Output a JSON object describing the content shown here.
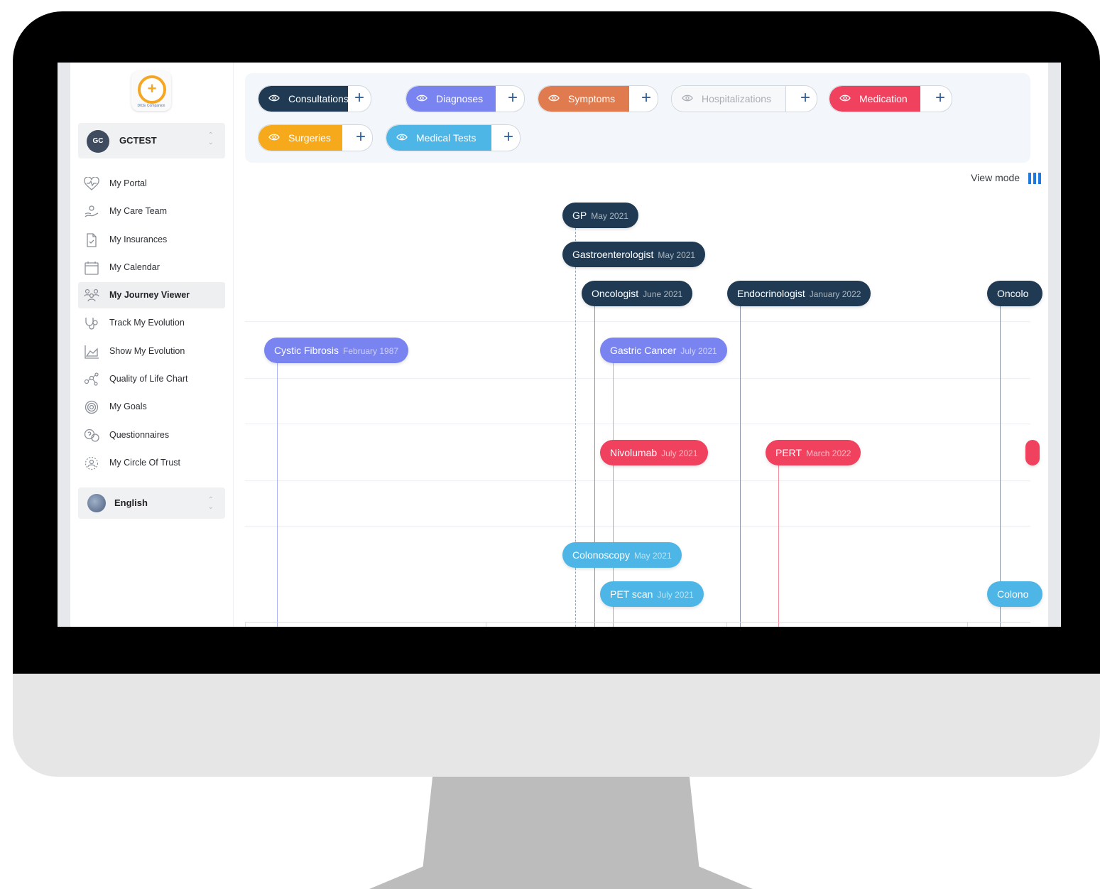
{
  "colors": {
    "consultations": "#1f3a52",
    "diagnoses": "#7a84f0",
    "symptoms": "#e07a4f",
    "hospitalizations": "#b8bcc3",
    "medication": "#f0425f",
    "surgeries": "#f5a91b",
    "medical_tests": "#4db6e6"
  },
  "sidebar": {
    "user_initials": "GC",
    "user_name": "GCTEST",
    "nav": [
      {
        "label": "My Portal",
        "icon": "heart-pulse-icon"
      },
      {
        "label": "My Care Team",
        "icon": "care-team-icon"
      },
      {
        "label": "My Insurances",
        "icon": "insurance-document-icon"
      },
      {
        "label": "My Calendar",
        "icon": "calendar-icon"
      },
      {
        "label": "My Journey Viewer",
        "icon": "people-group-icon",
        "active": true
      },
      {
        "label": "Track My Evolution",
        "icon": "stethoscope-icon"
      },
      {
        "label": "Show My Evolution",
        "icon": "area-chart-icon"
      },
      {
        "label": "Quality of Life Chart",
        "icon": "network-icon"
      },
      {
        "label": "My Goals",
        "icon": "target-icon"
      },
      {
        "label": "Questionnaires",
        "icon": "question-bubble-icon"
      },
      {
        "label": "My Circle Of Trust",
        "icon": "circle-of-trust-icon"
      }
    ],
    "language": "English"
  },
  "filters": [
    {
      "key": "consultations",
      "label": "Consultations",
      "plus": "+"
    },
    {
      "key": "diagnoses",
      "label": "Diagnoses",
      "plus": "+"
    },
    {
      "key": "symptoms",
      "label": "Symptoms",
      "plus": "+"
    },
    {
      "key": "hospitalizations",
      "label": "Hospitalizations",
      "plus": "+"
    },
    {
      "key": "medication",
      "label": "Medication",
      "plus": "+"
    },
    {
      "key": "surgeries",
      "label": "Surgeries",
      "plus": "+"
    },
    {
      "key": "medical_tests",
      "label": "Medical Tests",
      "plus": "+"
    }
  ],
  "view_mode_label": "View mode",
  "timeline": {
    "consultations": [
      {
        "title": "GP",
        "date": "May 2021"
      },
      {
        "title": "Gastroenterologist",
        "date": "May 2021"
      },
      {
        "title": "Oncologist",
        "date": "June 2021"
      },
      {
        "title": "Endocrinologist",
        "date": "January 2022"
      },
      {
        "title": "Oncolo",
        "date": ""
      }
    ],
    "diagnoses": [
      {
        "title": "Cystic Fibrosis",
        "date": "February 1987"
      },
      {
        "title": "Gastric Cancer",
        "date": "July 2021"
      }
    ],
    "medication": [
      {
        "title": "Nivolumab",
        "date": "July 2021"
      },
      {
        "title": "PERT",
        "date": "March 2022"
      }
    ],
    "medical_tests": [
      {
        "title": "Colonoscopy",
        "date": "May 2021"
      },
      {
        "title": "PET scan",
        "date": "July 2021"
      },
      {
        "title": "Colono",
        "date": ""
      }
    ]
  }
}
